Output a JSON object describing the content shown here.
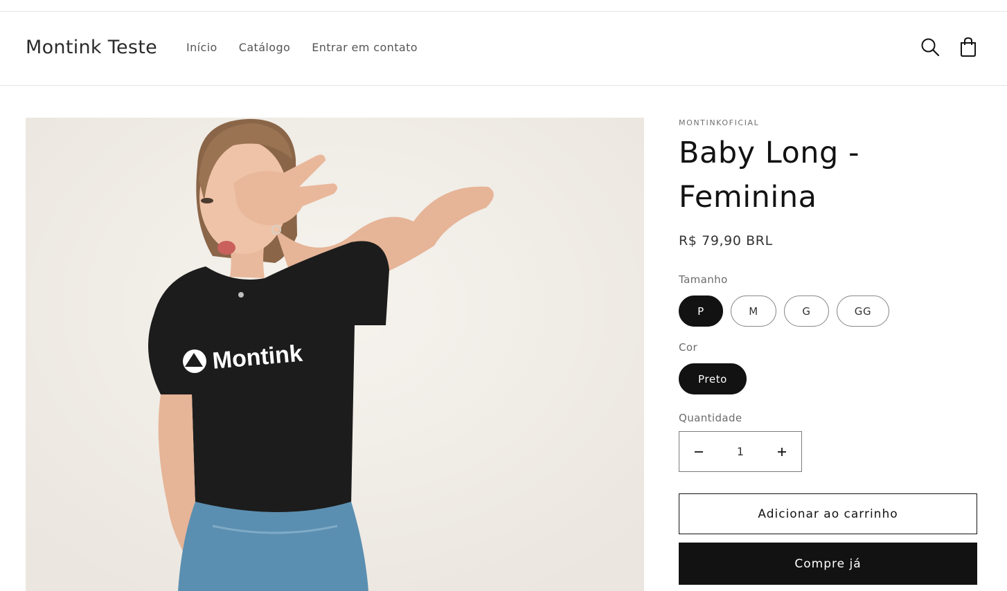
{
  "header": {
    "logo": "Montink Teste",
    "nav": [
      "Início",
      "Catálogo",
      "Entrar em contato"
    ],
    "search_icon": "search-icon",
    "cart_icon": "bag-icon"
  },
  "product": {
    "vendor": "MONTINKOFICIAL",
    "title_line1": "Baby Long -",
    "title_line2": "Feminina",
    "price": "R$ 79,90 BRL",
    "size_label": "Tamanho",
    "sizes": [
      "P",
      "M",
      "G",
      "GG"
    ],
    "selected_size": "P",
    "color_label": "Cor",
    "colors": [
      "Preto"
    ],
    "selected_color": "Preto",
    "quantity_label": "Quantidade",
    "quantity": "1",
    "add_to_cart": "Adicionar ao carrinho",
    "buy_now": "Compre já",
    "image": {
      "shirt_print": "Montink"
    }
  },
  "colors": {
    "primary": "#121212",
    "background": "#ffffff",
    "photo_background": "#f1ede8"
  }
}
